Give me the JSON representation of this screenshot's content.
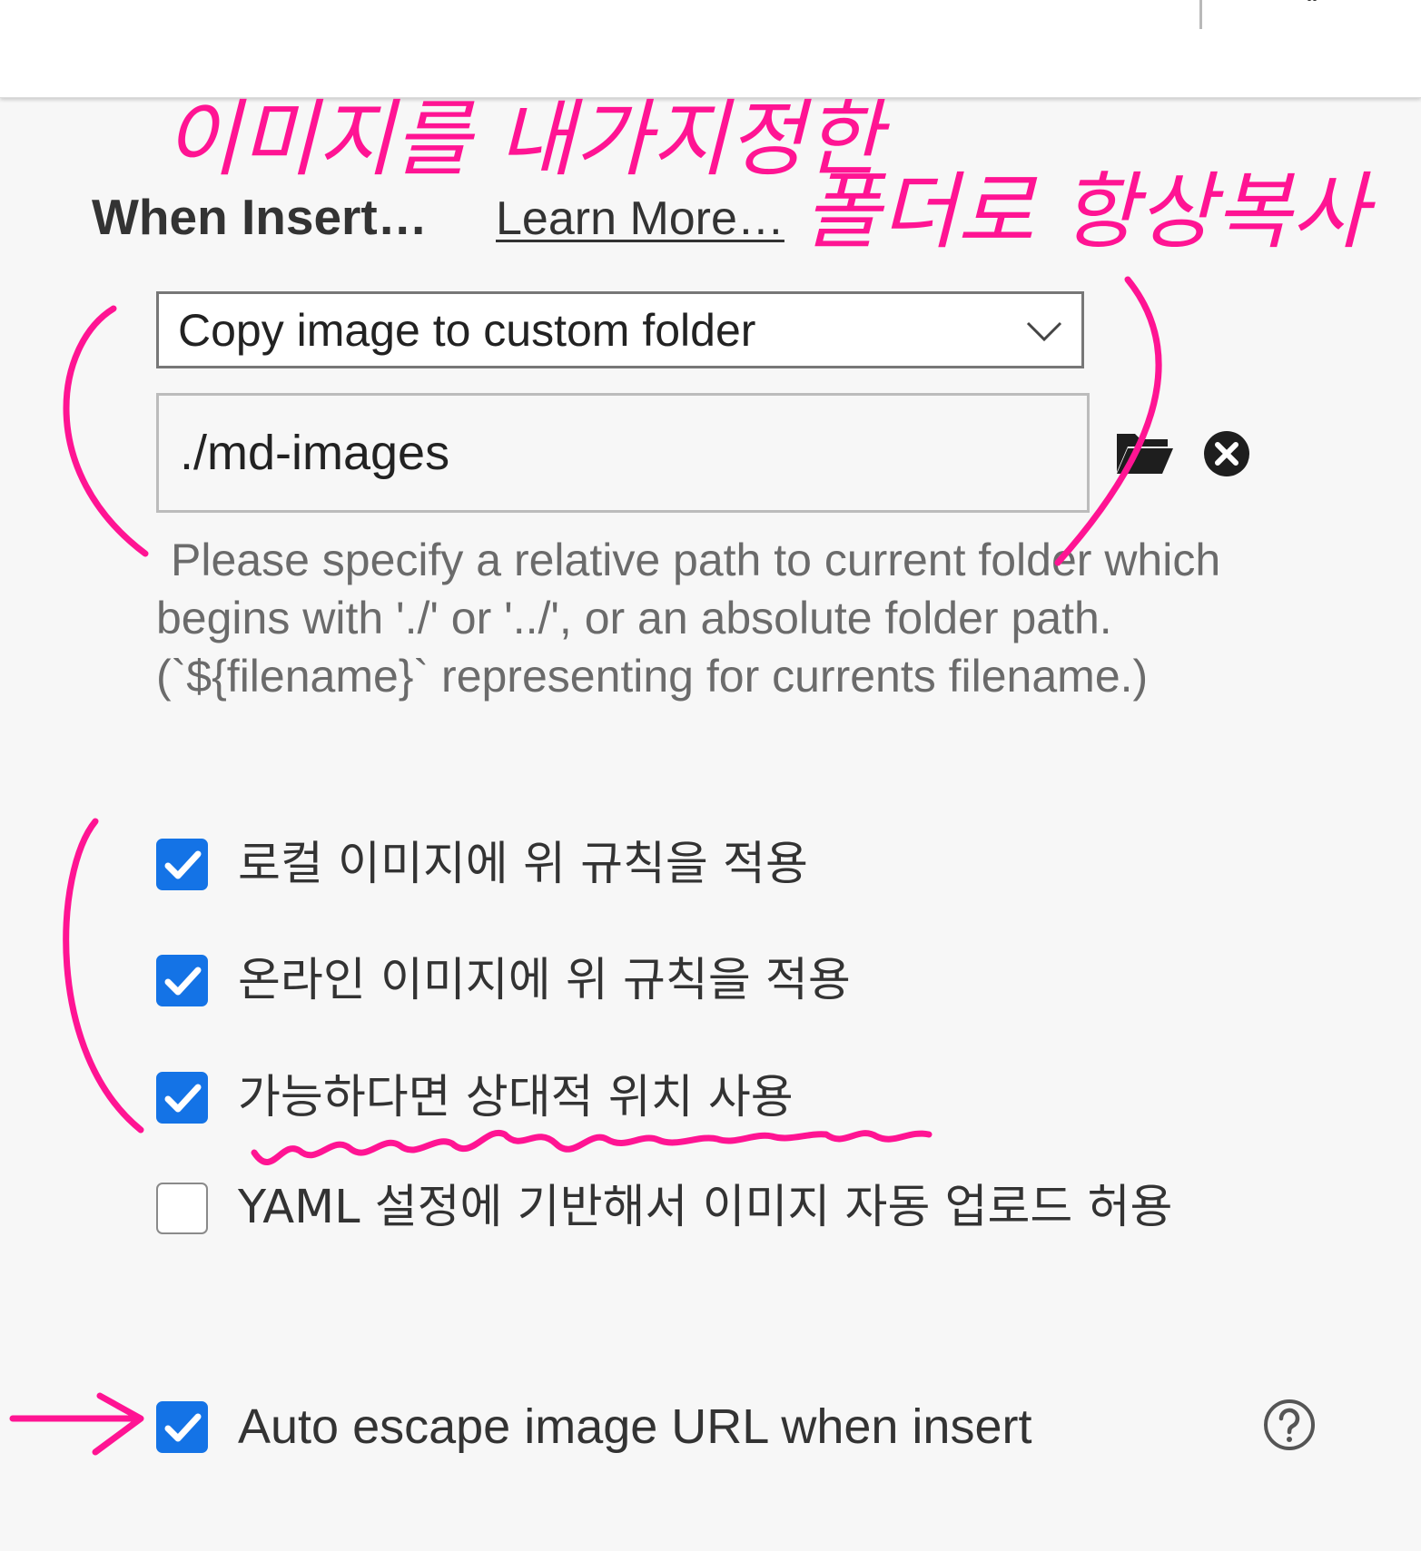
{
  "section": {
    "title": "When Insert…",
    "learn_more_label": "Learn More…"
  },
  "image_action": {
    "selected": "Copy image to custom folder"
  },
  "folder_path": {
    "value": "./md-images"
  },
  "hint": {
    "text": "Please specify a relative path to current folder which begins with './' or '../', or an absolute folder path. (`${filename}` representing for currents filename.)"
  },
  "options": [
    {
      "label": "로컬 이미지에 위 규칙을 적용",
      "checked": true
    },
    {
      "label": "온라인 이미지에 위 규칙을 적용",
      "checked": true
    },
    {
      "label": "가능하다면 상대적 위치 사용",
      "checked": true
    },
    {
      "label": "YAML 설정에 기반해서 이미지 자동 업로드 허용",
      "checked": false
    },
    {
      "label": "Auto escape image URL when insert",
      "checked": true
    }
  ],
  "annotation": {
    "line1": "이미지를 내가지정한",
    "line2": "폴더로 항상복사",
    "color": "#ff1493"
  },
  "colors": {
    "checkbox_checked": "#1473e6",
    "annotation_ink": "#ff1493"
  },
  "icons": {
    "close": "close-icon",
    "chevron": "chevron-down-icon",
    "folder": "folder-open-icon",
    "clear": "clear-circle-icon",
    "help": "help-circle-icon",
    "check": "checkmark-icon"
  }
}
